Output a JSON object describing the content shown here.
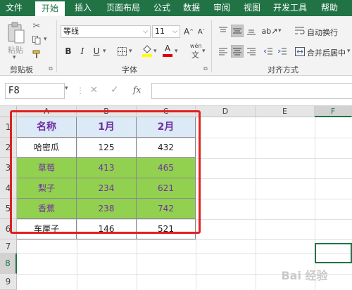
{
  "menu": {
    "tabs": [
      {
        "label": "文件"
      },
      {
        "label": "开始"
      },
      {
        "label": "插入"
      },
      {
        "label": "页面布局"
      },
      {
        "label": "公式"
      },
      {
        "label": "数据"
      },
      {
        "label": "审阅"
      },
      {
        "label": "视图"
      },
      {
        "label": "开发工具"
      },
      {
        "label": "帮助"
      }
    ],
    "active_tab": "开始"
  },
  "ribbon": {
    "clipboard": {
      "paste_label": "粘贴",
      "group_label": "剪贴板"
    },
    "font": {
      "font_name": "等线",
      "font_size": "11",
      "group_label": "字体",
      "increase_label": "A",
      "decrease_label": "A",
      "bold": "B",
      "italic": "I",
      "underline": "U",
      "wen_label": "wén"
    },
    "alignment": {
      "wrap_text_label": "自动换行",
      "merge_center_label": "合并后居中",
      "group_label": "对齐方式"
    }
  },
  "formula_bar": {
    "name_box": "F8",
    "fx_label": "fx",
    "formula": ""
  },
  "columns": [
    "A",
    "B",
    "C",
    "D",
    "E",
    "F"
  ],
  "rows": [
    "1",
    "2",
    "3",
    "4",
    "5",
    "6",
    "7",
    "8",
    "9"
  ],
  "table": {
    "header": [
      "名称",
      "1月",
      "2月"
    ],
    "rows": [
      {
        "name": "哈密瓜",
        "jan": "125",
        "feb": "432",
        "highlight": false
      },
      {
        "name": "草莓",
        "jan": "413",
        "feb": "465",
        "highlight": true
      },
      {
        "name": "梨子",
        "jan": "234",
        "feb": "621",
        "highlight": true
      },
      {
        "name": "香蕉",
        "jan": "238",
        "feb": "742",
        "highlight": true
      },
      {
        "name": "车厘子",
        "jan": "146",
        "feb": "521",
        "highlight": false
      }
    ]
  },
  "selected_cell": "F8",
  "colors": {
    "accent": "#217346",
    "highlight_fill": "#92d050",
    "header_fill": "#dce9f6",
    "highlight_text": "#7030a0",
    "frame": "#e02020"
  },
  "watermark": "Bai 经验"
}
